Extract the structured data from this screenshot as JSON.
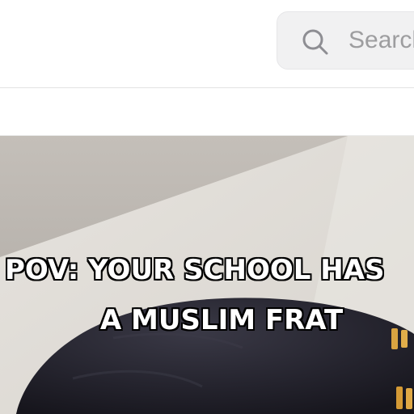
{
  "search": {
    "placeholder": "Search"
  },
  "video": {
    "caption_line_1": "POV: YOUR SCHOOL HAS",
    "caption_line_2": "A MUSLIM FRAT"
  },
  "colors": {
    "search_bg": "#f1f1f2",
    "placeholder_text": "#9d9d9f",
    "caption_text": "#ffffff",
    "caption_outline": "#000000"
  },
  "icons": [
    "search-icon"
  ]
}
